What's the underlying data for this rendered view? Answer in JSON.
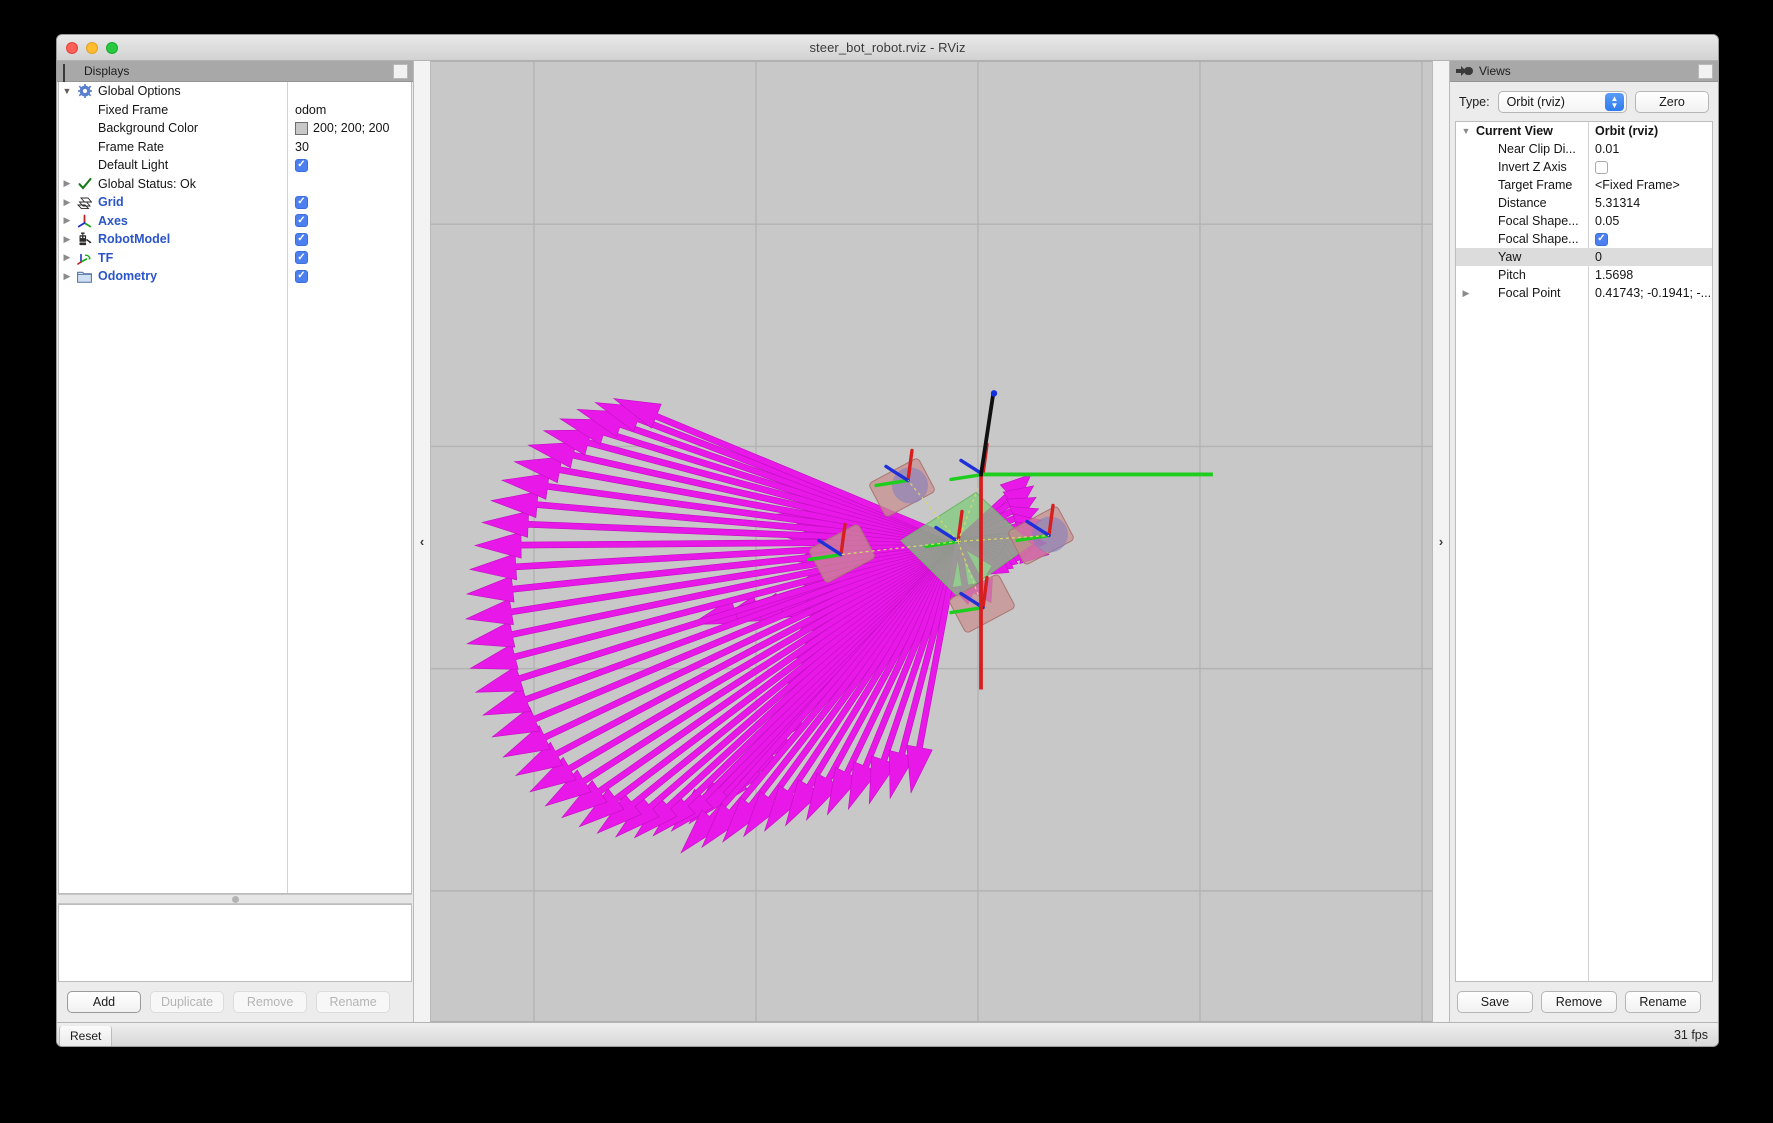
{
  "window": {
    "title": "steer_bot_robot.rviz - RViz",
    "traffic_lights": [
      "close-button",
      "minimize-button",
      "maximize-button"
    ]
  },
  "displays_panel": {
    "title": "Displays",
    "icon": "displays-monitor-icon",
    "float_button": "float-panel-button",
    "tree": [
      {
        "name": "Global Options",
        "twisty": "▼",
        "icon": "gear-icon",
        "link": false,
        "indent": false,
        "value_type": "none",
        "value": ""
      },
      {
        "name": "Fixed Frame",
        "twisty": "",
        "icon": "",
        "link": false,
        "indent": true,
        "value_type": "text",
        "value": "odom"
      },
      {
        "name": "Background Color",
        "twisty": "",
        "icon": "",
        "link": false,
        "indent": true,
        "value_type": "color",
        "value": "200; 200; 200"
      },
      {
        "name": "Frame Rate",
        "twisty": "",
        "icon": "",
        "link": false,
        "indent": true,
        "value_type": "text",
        "value": "30"
      },
      {
        "name": "Default Light",
        "twisty": "",
        "icon": "",
        "link": false,
        "indent": true,
        "value_type": "checkbox",
        "value": "checked"
      },
      {
        "name": "Global Status: Ok",
        "twisty": "▶",
        "icon": "green-check-icon",
        "link": false,
        "indent": false,
        "value_type": "none",
        "value": ""
      },
      {
        "name": "Grid",
        "twisty": "▶",
        "icon": "grid-icon",
        "link": true,
        "indent": false,
        "value_type": "checkbox",
        "value": "checked"
      },
      {
        "name": "Axes",
        "twisty": "▶",
        "icon": "axes-icon",
        "link": true,
        "indent": false,
        "value_type": "checkbox",
        "value": "checked"
      },
      {
        "name": "RobotModel",
        "twisty": "▶",
        "icon": "robot-icon",
        "link": true,
        "indent": false,
        "value_type": "checkbox",
        "value": "checked"
      },
      {
        "name": "TF",
        "twisty": "▶",
        "icon": "tf-axes-icon",
        "link": true,
        "indent": false,
        "value_type": "checkbox",
        "value": "checked"
      },
      {
        "name": "Odometry",
        "twisty": "▶",
        "icon": "folder-icon",
        "link": true,
        "indent": false,
        "value_type": "checkbox",
        "value": "checked"
      }
    ],
    "description_text": "",
    "buttons": [
      {
        "label": "Add",
        "enabled": true
      },
      {
        "label": "Duplicate",
        "enabled": false
      },
      {
        "label": "Remove",
        "enabled": false
      },
      {
        "label": "Rename",
        "enabled": false
      }
    ]
  },
  "viewport": {
    "collapse_left": "‹",
    "collapse_right": "›",
    "background_color": "#c8c8c8",
    "grid_color": "#b4b4b4",
    "axes": {
      "y_axis_color": "#22cc22",
      "x_axis_color": "#d02020",
      "z_axis_color": "#101010"
    },
    "odometry_arrow_color": "#e818e8",
    "robot_body_color": "#8fd48f",
    "robot_wheel_color": "#d29a98"
  },
  "views_panel": {
    "title": "Views",
    "icon": "views-camera-icon",
    "float_button": "float-panel-button",
    "type_label": "Type:",
    "type_value": "Orbit (rviz)",
    "zero_button": "Zero",
    "tree": [
      {
        "name": "Current View",
        "value": "Orbit (rviz)",
        "twisty": "▼",
        "header": true,
        "child": false,
        "value_type": "text",
        "selected": false
      },
      {
        "name": "Near Clip Di...",
        "value": "0.01",
        "twisty": "",
        "header": false,
        "child": true,
        "value_type": "text",
        "selected": false
      },
      {
        "name": "Invert Z Axis",
        "value": "",
        "twisty": "",
        "header": false,
        "child": true,
        "value_type": "checkbox-empty",
        "selected": false
      },
      {
        "name": "Target Frame",
        "value": "<Fixed Frame>",
        "twisty": "",
        "header": false,
        "child": true,
        "value_type": "text",
        "selected": false
      },
      {
        "name": "Distance",
        "value": "5.31314",
        "twisty": "",
        "header": false,
        "child": true,
        "value_type": "text",
        "selected": false
      },
      {
        "name": "Focal Shape...",
        "value": "0.05",
        "twisty": "",
        "header": false,
        "child": true,
        "value_type": "text",
        "selected": false
      },
      {
        "name": "Focal Shape...",
        "value": "",
        "twisty": "",
        "header": false,
        "child": true,
        "value_type": "checkbox",
        "selected": false
      },
      {
        "name": "Yaw",
        "value": "0",
        "twisty": "",
        "header": false,
        "child": true,
        "value_type": "text",
        "selected": true
      },
      {
        "name": "Pitch",
        "value": "1.5698",
        "twisty": "",
        "header": false,
        "child": true,
        "value_type": "text",
        "selected": false
      },
      {
        "name": "Focal Point",
        "value": "0.41743; -0.1941; -...",
        "twisty": "▶",
        "header": false,
        "child": true,
        "value_type": "text",
        "selected": false
      }
    ],
    "buttons": [
      {
        "label": "Save",
        "enabled": true
      },
      {
        "label": "Remove",
        "enabled": true
      },
      {
        "label": "Rename",
        "enabled": true
      }
    ]
  },
  "status_bar": {
    "reset_label": "Reset",
    "fps_label": "31 fps"
  }
}
